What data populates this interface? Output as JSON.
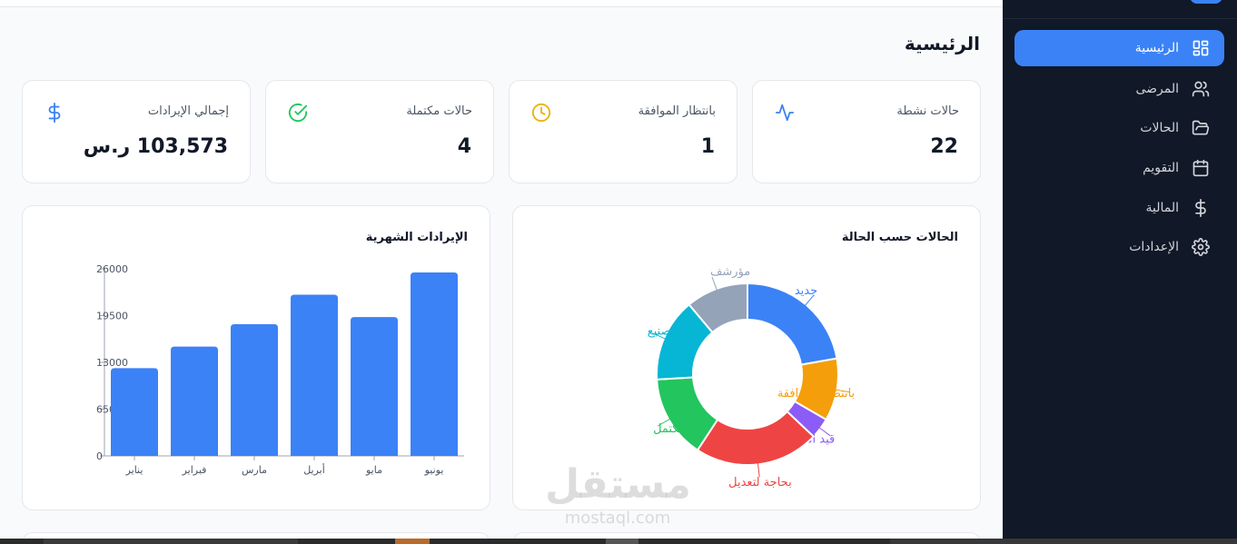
{
  "page": {
    "title": "الرئيسية"
  },
  "sidebar": {
    "items": [
      {
        "label": "الرئيسية",
        "icon": "grid-icon",
        "active": true
      },
      {
        "label": "المرضى",
        "icon": "users-icon",
        "active": false
      },
      {
        "label": "الحالات",
        "icon": "folder-open-icon",
        "active": false
      },
      {
        "label": "التقويم",
        "icon": "calendar-icon",
        "active": false
      },
      {
        "label": "المالية",
        "icon": "dollar-icon",
        "active": false
      },
      {
        "label": "الإعدادات",
        "icon": "gear-icon",
        "active": false
      }
    ]
  },
  "stats": [
    {
      "label": "حالات نشطة",
      "value": "22",
      "icon": "activity-icon",
      "color": "#3b82f6"
    },
    {
      "label": "بانتظار الموافقة",
      "value": "1",
      "icon": "clock-icon",
      "color": "#eab308"
    },
    {
      "label": "حالات مكتملة",
      "value": "4",
      "icon": "check-circle-icon",
      "color": "#22c55e"
    },
    {
      "label": "إجمالي الإيرادات",
      "value": "103,573 ر.س",
      "icon": "dollar-icon",
      "color": "#3b82f6"
    }
  ],
  "cards": {
    "status_title": "الحالات حسب الحالة",
    "revenue_title": "الإيرادات الشهرية"
  },
  "chart_data": [
    {
      "type": "pie",
      "title": "الحالات حسب الحالة",
      "categories": [
        "جديد",
        "بانتظار الموافقة",
        "قيد المراجعة",
        "بحاجة لتعديل",
        "مكتمل",
        "قيد التصنيع",
        "مؤرشف"
      ],
      "values": [
        6,
        3,
        1,
        6,
        4,
        4,
        3
      ],
      "colors": [
        "#3b82f6",
        "#f59e0b",
        "#8b5cf6",
        "#ef4444",
        "#22c55e",
        "#06b6d4",
        "#94a3b8"
      ]
    },
    {
      "type": "bar",
      "title": "الإيرادات الشهرية",
      "categories": [
        "يناير",
        "فبراير",
        "مارس",
        "أبريل",
        "مايو",
        "يونيو"
      ],
      "values": [
        12200,
        15200,
        18300,
        22400,
        19300,
        25500
      ],
      "ylim": [
        0,
        26000
      ],
      "yticks": [
        0,
        6500,
        13000,
        19500,
        26000
      ],
      "color": "#3b82f6"
    }
  ],
  "watermark": {
    "big": "مستقل",
    "small": "mostaql.com"
  },
  "colors": {
    "accent": "#3b82f6",
    "sidebar_bg": "#111827"
  }
}
